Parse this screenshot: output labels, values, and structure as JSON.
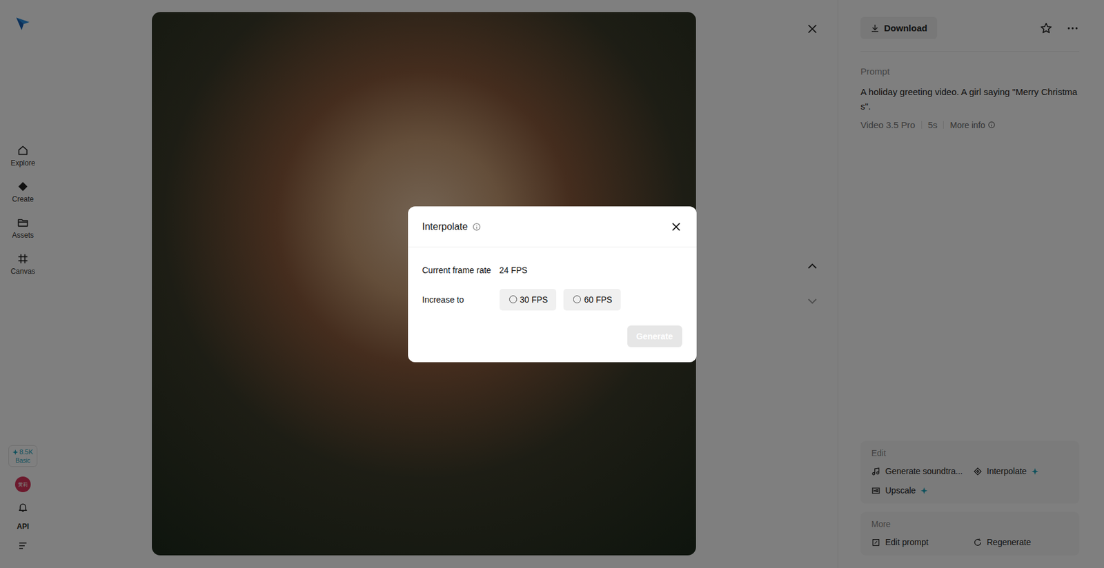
{
  "sidebar": {
    "items": [
      {
        "label": "Explore"
      },
      {
        "label": "Create"
      },
      {
        "label": "Assets"
      },
      {
        "label": "Canvas"
      }
    ],
    "credits": {
      "amount": "8.5K",
      "plan": "Basic"
    },
    "avatar": "黄莉",
    "api": "API"
  },
  "panel": {
    "download": "Download",
    "prompt_label": "Prompt",
    "prompt": "A holiday greeting video. A girl saying \"Merry Christmas\".",
    "meta": [
      "Video 3.5 Pro",
      "5s"
    ],
    "more_info": "More info",
    "edit": {
      "title": "Edit",
      "actions": [
        {
          "label": "Generate soundtra...",
          "premium": false
        },
        {
          "label": "Interpolate",
          "premium": true
        },
        {
          "label": "Upscale",
          "premium": true
        }
      ]
    },
    "more": {
      "title": "More",
      "actions": [
        "Edit prompt",
        "Regenerate"
      ]
    }
  },
  "dialog": {
    "title": "Interpolate",
    "current_label": "Current frame rate",
    "current_value": "24 FPS",
    "increase_label": "Increase to",
    "options": [
      {
        "label": "30 FPS",
        "selected": false
      },
      {
        "label": "60 FPS",
        "selected": false
      }
    ],
    "generate": {
      "label": "Generate",
      "disabled": true
    }
  }
}
